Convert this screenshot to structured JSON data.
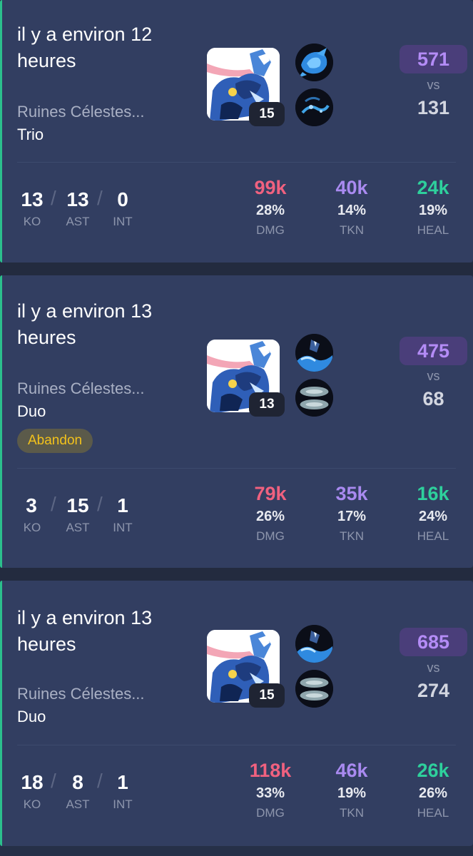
{
  "colors": {
    "damage": "#f0617f",
    "tank": "#a98af0",
    "heal": "#2ed09c",
    "score_accent": "#b48cf6",
    "badge_text": "#f3c21b"
  },
  "matches": [
    {
      "time": "il y a environ 12 heures",
      "map": "Ruines Célestes...",
      "mode": "Trio",
      "badge": "",
      "level": "15",
      "pokemon_icon": "greninja-icon",
      "move1_icon": "water-shuriken-icon",
      "move2_icon": "dark-splash-icon",
      "score_team": "571",
      "vs": "vs",
      "score_opp": "131",
      "ko": "13",
      "ast": "13",
      "int": "0",
      "ko_label": "KO",
      "ast_label": "AST",
      "int_label": "INT",
      "dmg": "99k",
      "dmg_pct": "28%",
      "dmg_label": "DMG",
      "tkn": "40k",
      "tkn_pct": "14%",
      "tkn_label": "TKN",
      "heal": "24k",
      "heal_pct": "19%",
      "heal_label": "HEAL"
    },
    {
      "time": "il y a environ 13 heures",
      "map": "Ruines Célestes...",
      "mode": "Duo",
      "badge": "Abandon",
      "level": "13",
      "pokemon_icon": "greninja-icon",
      "move1_icon": "surf-icon",
      "move2_icon": "smokescreen-icon",
      "score_team": "475",
      "vs": "vs",
      "score_opp": "68",
      "ko": "3",
      "ast": "15",
      "int": "1",
      "ko_label": "KO",
      "ast_label": "AST",
      "int_label": "INT",
      "dmg": "79k",
      "dmg_pct": "26%",
      "dmg_label": "DMG",
      "tkn": "35k",
      "tkn_pct": "17%",
      "tkn_label": "TKN",
      "heal": "16k",
      "heal_pct": "24%",
      "heal_label": "HEAL"
    },
    {
      "time": "il y a environ 13 heures",
      "map": "Ruines Célestes...",
      "mode": "Duo",
      "badge": "",
      "level": "15",
      "pokemon_icon": "greninja-icon",
      "move1_icon": "surf-icon",
      "move2_icon": "smokescreen-icon",
      "score_team": "685",
      "vs": "vs",
      "score_opp": "274",
      "ko": "18",
      "ast": "8",
      "int": "1",
      "ko_label": "KO",
      "ast_label": "AST",
      "int_label": "INT",
      "dmg": "118k",
      "dmg_pct": "33%",
      "dmg_label": "DMG",
      "tkn": "46k",
      "tkn_pct": "19%",
      "tkn_label": "TKN",
      "heal": "26k",
      "heal_pct": "26%",
      "heal_label": "HEAL"
    }
  ]
}
